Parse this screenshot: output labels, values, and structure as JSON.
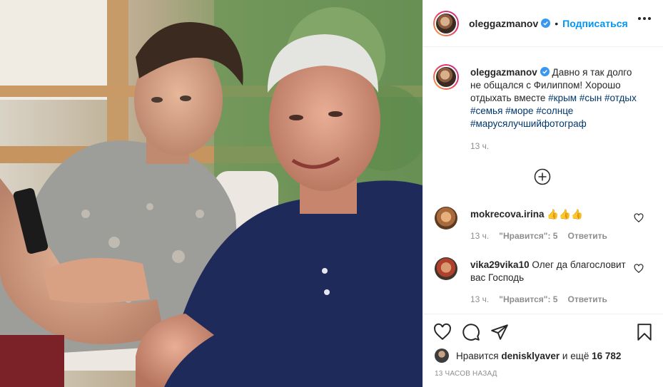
{
  "header": {
    "username": "oleggazmanov",
    "separator": "•",
    "follow_label": "Подписаться"
  },
  "caption": {
    "username": "oleggazmanov",
    "text": "Давно я так долго не общался с Филиппом! Хорошо отдыхать вместе",
    "hashtags": [
      "#крым",
      "#сын",
      "#отдых",
      "#семья",
      "#море",
      "#солнце",
      "#марусялучшийфотограф"
    ],
    "time": "13 ч."
  },
  "comments": [
    {
      "username": "mokrecova.irina",
      "text": "👍👍👍",
      "time": "13 ч.",
      "likes_label": "\"Нравится\": 5",
      "reply_label": "Ответить"
    },
    {
      "username": "vika29vika10",
      "text": "Олег да благословит вас Господь",
      "time": "13 ч.",
      "likes_label": "\"Нравится\": 5",
      "reply_label": "Ответить"
    }
  ],
  "likes": {
    "prefix": "Нравится",
    "user": "denisklyaver",
    "and_more": "и ещё",
    "count": "16 782"
  },
  "post_time": "13 часов назад",
  "colors": {
    "accent": "#0095f6",
    "hashtag": "#00376b",
    "muted": "#8e8e8e",
    "text": "#262626"
  },
  "icons": [
    "verified-badge",
    "more-options-icon",
    "add-comment-plus-icon",
    "heart-icon",
    "comment-icon",
    "share-icon",
    "bookmark-icon"
  ]
}
